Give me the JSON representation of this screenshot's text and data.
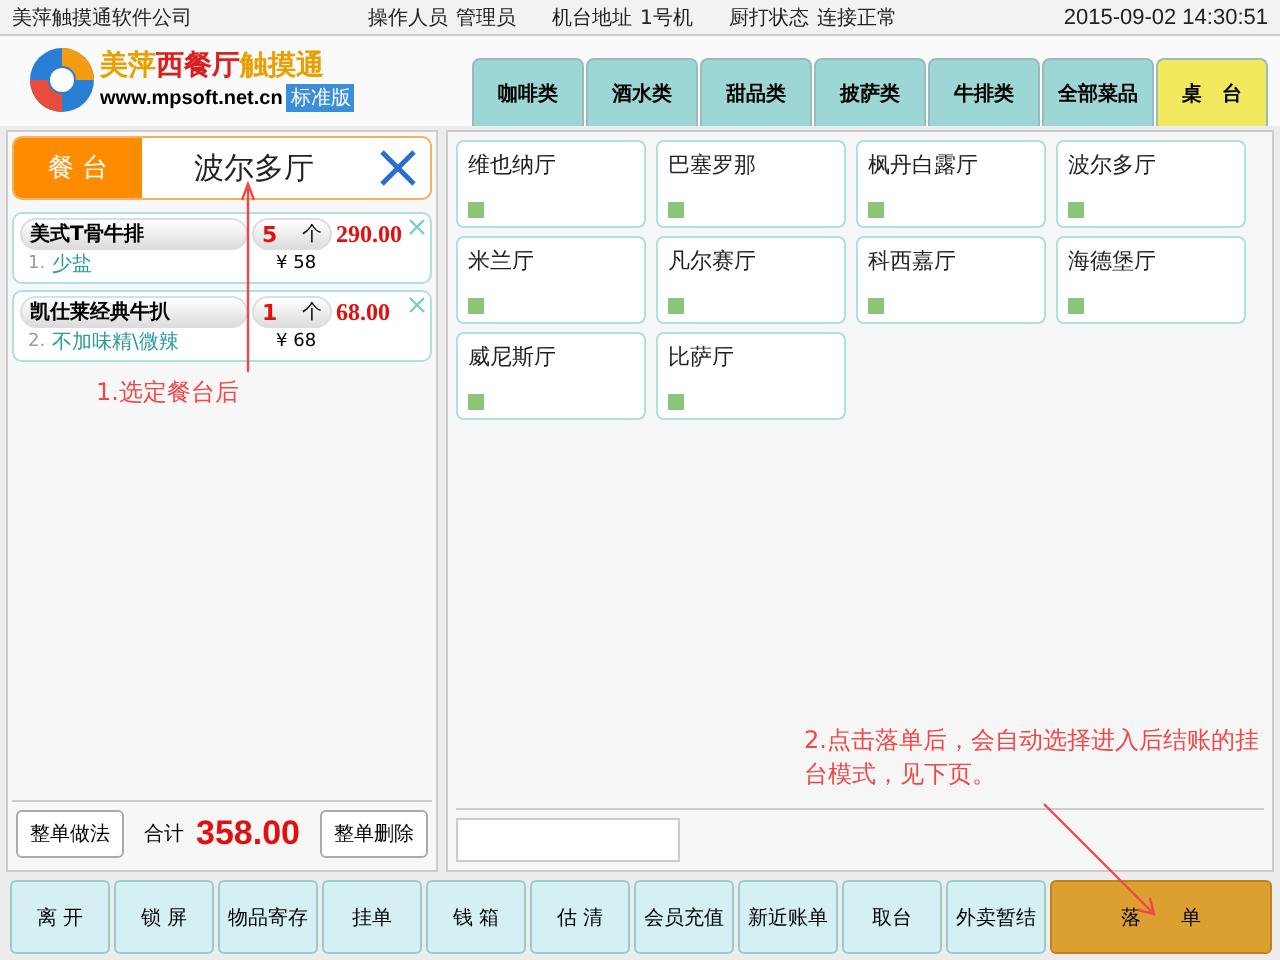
{
  "top_bar": {
    "company": "美萍触摸通软件公司",
    "operator_label": "操作人员",
    "operator": "管理员",
    "terminal_label": "机台地址",
    "terminal": "1号机",
    "printer_label": "厨打状态",
    "printer_status": "连接正常",
    "datetime": "2015-09-02 14:30:51"
  },
  "logo": {
    "title_part1": "美萍",
    "title_part2": "西餐厅",
    "title_part3": "触摸通",
    "url": "www.mpsoft.net.cn",
    "edition": "标准版"
  },
  "tabs": [
    {
      "label": "咖啡类",
      "selected": false
    },
    {
      "label": "酒水类",
      "selected": false
    },
    {
      "label": "甜品类",
      "selected": false
    },
    {
      "label": "披萨类",
      "selected": false
    },
    {
      "label": "牛排类",
      "selected": false
    },
    {
      "label": "全部菜品",
      "selected": false
    },
    {
      "label": "桌　台",
      "selected": true
    }
  ],
  "order": {
    "table_label": "餐 台",
    "table_name": "波尔多厅",
    "items": [
      {
        "name": "美式T骨牛排",
        "qty": "5",
        "unit": "个",
        "amount": "290.00",
        "index": "1.",
        "note": "少盐",
        "price": "¥ 58"
      },
      {
        "name": "凯仕莱经典牛扒",
        "qty": "1",
        "unit": "个",
        "amount": "68.00",
        "index": "2.",
        "note": "不加味精\\微辣",
        "price": "¥ 68"
      }
    ],
    "method_button": "整单做法",
    "total_label": "合计",
    "total": "358.00",
    "delete_button": "整单删除"
  },
  "tables": [
    {
      "name": "维也纳厅"
    },
    {
      "name": "巴塞罗那"
    },
    {
      "name": "枫丹白露厅"
    },
    {
      "name": "波尔多厅"
    },
    {
      "name": "米兰厅"
    },
    {
      "name": "凡尔赛厅"
    },
    {
      "name": "科西嘉厅"
    },
    {
      "name": "海德堡厅"
    },
    {
      "name": "威尼斯厅"
    },
    {
      "name": "比萨厅"
    }
  ],
  "annotations": [
    "1.选定餐台后",
    "2.点击落单后，会自动选择进入后结账的挂台模式，见下页。"
  ],
  "bottom_buttons": [
    {
      "label": "离 开",
      "kind": "normal"
    },
    {
      "label": "锁 屏",
      "kind": "normal"
    },
    {
      "label": "物品寄存",
      "kind": "normal"
    },
    {
      "label": "挂单",
      "kind": "normal"
    },
    {
      "label": "钱 箱",
      "kind": "normal"
    },
    {
      "label": "估 清",
      "kind": "normal"
    },
    {
      "label": "会员充值",
      "kind": "normal"
    },
    {
      "label": "新近账单",
      "kind": "normal"
    },
    {
      "label": "取台",
      "kind": "normal"
    },
    {
      "label": "外卖暂结",
      "kind": "normal"
    },
    {
      "label": "落　　单",
      "kind": "primary"
    }
  ]
}
